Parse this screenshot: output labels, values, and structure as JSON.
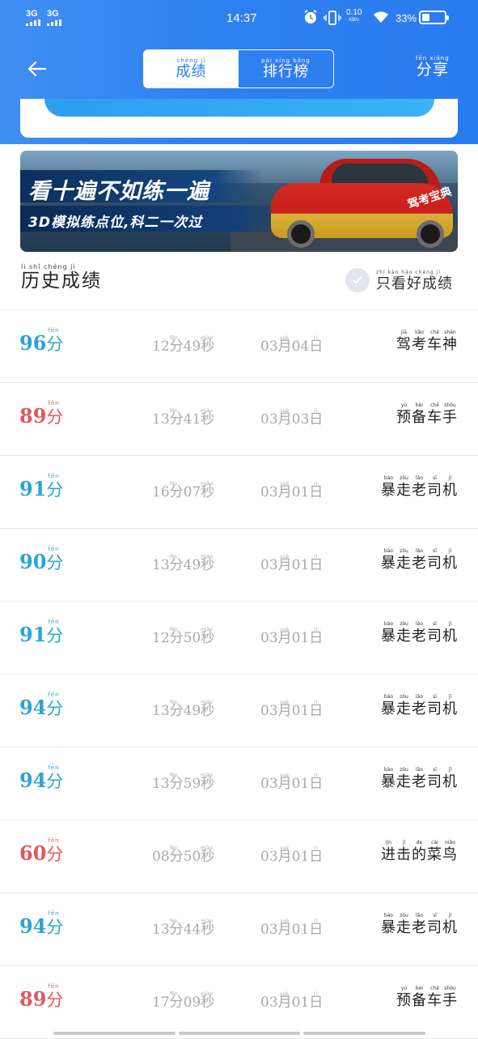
{
  "status_bar": {
    "signal1": "3G",
    "signal2": "3G",
    "time": "14:37",
    "net_speed": "0.10",
    "net_unit": "KB/s",
    "battery": "33%"
  },
  "nav": {
    "tabs": [
      {
        "pinyin": "chéng jì",
        "label": "成绩"
      },
      {
        "pinyin": "pái xíng bǎng",
        "label": "排行榜"
      }
    ],
    "share_pinyin": "fēn xiǎng",
    "share_label": "分享"
  },
  "banner": {
    "headline": "看十遍不如练一遍",
    "subline": "3D模拟练点位,科二一次过",
    "car_label": "驾考宝典"
  },
  "section": {
    "title_pinyin": "lì shǐ chéng jì",
    "title": "历史成绩",
    "filter_pinyin": "zhǐ kàn hǎo chéng jì",
    "filter_label": "只看好成绩"
  },
  "colors": {
    "pass": "#2aa5d6",
    "fail": "#e0575b",
    "header": "#2f80f0"
  },
  "records": [
    {
      "score": "96",
      "pass": true,
      "min": "12",
      "sec": "49",
      "month": "03",
      "day": "04",
      "title": "驾考车神",
      "title_pinyin": [
        "jià",
        "kǎo",
        "chē",
        "shén"
      ]
    },
    {
      "score": "89",
      "pass": false,
      "min": "13",
      "sec": "41",
      "month": "03",
      "day": "03",
      "title": "预备车手",
      "title_pinyin": [
        "yù",
        "bèi",
        "chē",
        "shǒu"
      ]
    },
    {
      "score": "91",
      "pass": true,
      "min": "16",
      "sec": "07",
      "month": "03",
      "day": "01",
      "title": "暴走老司机",
      "title_pinyin": [
        "bào",
        "zǒu",
        "lǎo",
        "sī",
        "jī"
      ]
    },
    {
      "score": "90",
      "pass": true,
      "min": "13",
      "sec": "49",
      "month": "03",
      "day": "01",
      "title": "暴走老司机",
      "title_pinyin": [
        "bào",
        "zǒu",
        "lǎo",
        "sī",
        "jī"
      ]
    },
    {
      "score": "91",
      "pass": true,
      "min": "12",
      "sec": "50",
      "month": "03",
      "day": "01",
      "title": "暴走老司机",
      "title_pinyin": [
        "bào",
        "zǒu",
        "lǎo",
        "sī",
        "jī"
      ]
    },
    {
      "score": "94",
      "pass": true,
      "min": "13",
      "sec": "49",
      "month": "03",
      "day": "01",
      "title": "暴走老司机",
      "title_pinyin": [
        "bào",
        "zǒu",
        "lǎo",
        "sī",
        "jī"
      ]
    },
    {
      "score": "94",
      "pass": true,
      "min": "13",
      "sec": "59",
      "month": "03",
      "day": "01",
      "title": "暴走老司机",
      "title_pinyin": [
        "bào",
        "zǒu",
        "lǎo",
        "sī",
        "jī"
      ]
    },
    {
      "score": "60",
      "pass": false,
      "min": "08",
      "sec": "50",
      "month": "03",
      "day": "01",
      "title": "进击的菜鸟",
      "title_pinyin": [
        "jìn",
        "jī",
        "de",
        "cài",
        "niǎo"
      ]
    },
    {
      "score": "94",
      "pass": true,
      "min": "13",
      "sec": "44",
      "month": "03",
      "day": "01",
      "title": "暴走老司机",
      "title_pinyin": [
        "bào",
        "zǒu",
        "lǎo",
        "sī",
        "jī"
      ]
    },
    {
      "score": "89",
      "pass": false,
      "min": "17",
      "sec": "09",
      "month": "03",
      "day": "01",
      "title": "预备车手",
      "title_pinyin": [
        "yù",
        "bèi",
        "chē",
        "shǒu"
      ]
    }
  ],
  "units": {
    "score_unit": "分",
    "score_unit_pinyin": "fēn",
    "min_unit": "分",
    "min_unit_pinyin": "fēn",
    "sec_unit": "秒",
    "sec_unit_pinyin": "miǎo",
    "month_unit": "月",
    "month_unit_pinyin": "yuè",
    "day_unit": "日",
    "day_unit_pinyin": "rì"
  }
}
